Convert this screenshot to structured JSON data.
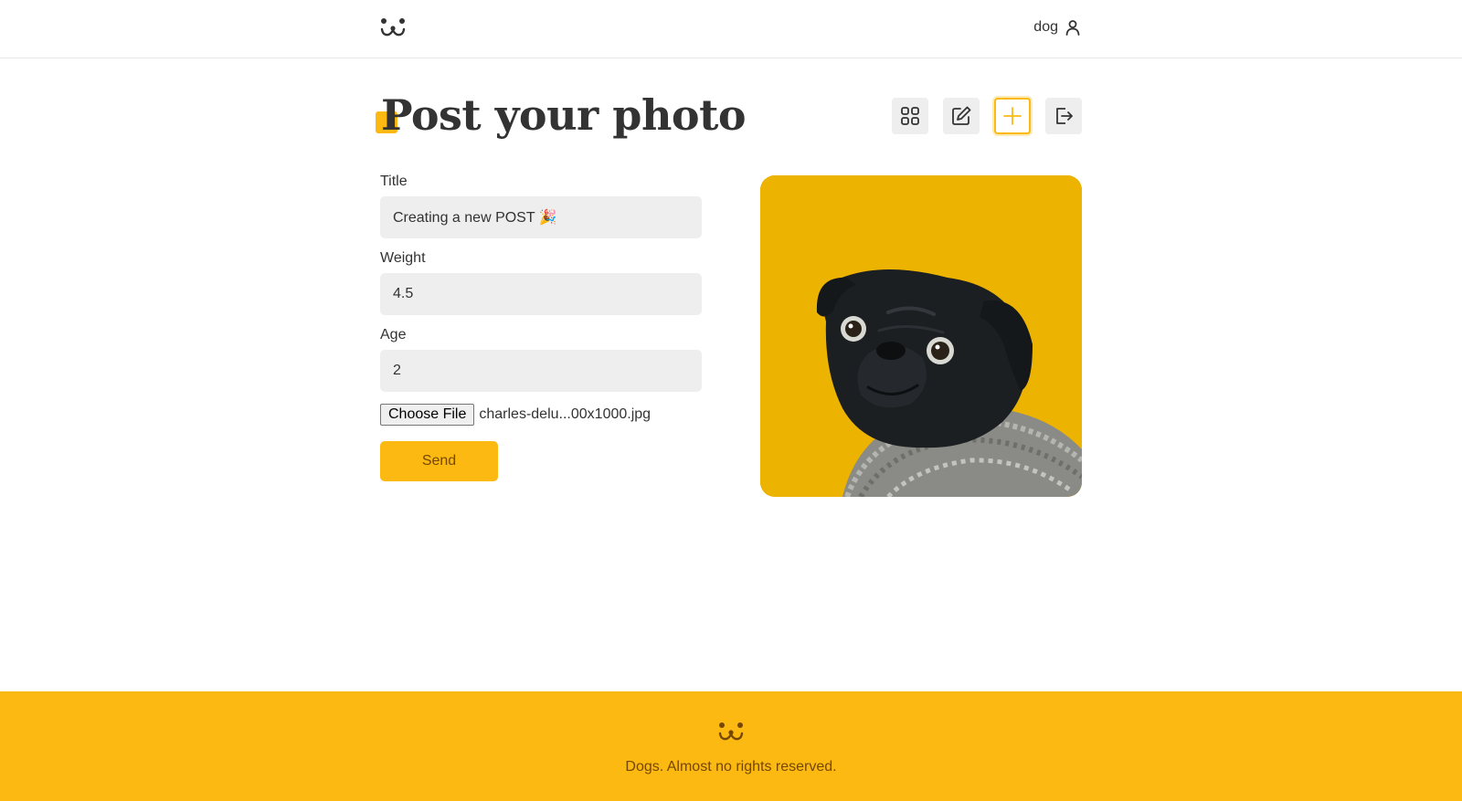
{
  "header": {
    "logo_icon": "dog-face-icon",
    "username": "dog",
    "user_icon": "user-icon"
  },
  "page": {
    "title": "Post your photo"
  },
  "toolbar": [
    {
      "name": "feed",
      "icon": "grid-icon",
      "active": false
    },
    {
      "name": "stats",
      "icon": "edit-icon",
      "active": false
    },
    {
      "name": "post",
      "icon": "plus-icon",
      "active": true
    },
    {
      "name": "logout",
      "icon": "logout-icon",
      "active": false
    }
  ],
  "form": {
    "title_label": "Title",
    "title_value": "Creating a new POST 🎉",
    "weight_label": "Weight",
    "weight_value": "4.5",
    "age_label": "Age",
    "age_value": "2",
    "file_button": "Choose File",
    "file_name": "charles-delu...00x1000.jpg",
    "submit_label": "Send"
  },
  "preview": {
    "subject": "black pug in grey knit sweater on yellow background"
  },
  "footer": {
    "logo_icon": "dog-face-icon",
    "text": "Dogs. Almost no rights reserved."
  },
  "colors": {
    "accent": "#fbb912",
    "accent_dark": "#764701",
    "input_bg": "#eeeeee",
    "text": "#333333",
    "preview_bg": "#ecb300"
  }
}
